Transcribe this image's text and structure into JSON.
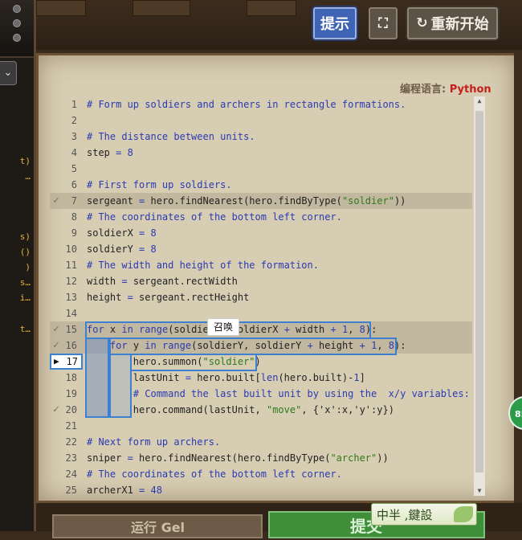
{
  "toolbar": {
    "hint_label": "提示",
    "fullscreen_icon": "⛶",
    "restart_icon": "↻",
    "restart_label": "重新开始"
  },
  "editor": {
    "language_prefix": "编程语言: ",
    "language": "Python",
    "current_line": "17",
    "tooltip": "召唤",
    "lines": [
      {
        "n": "1",
        "text": "# Form up soldiers and archers in rectangle formations.",
        "type": "comment"
      },
      {
        "n": "2",
        "text": "",
        "type": "code"
      },
      {
        "n": "3",
        "text": "# The distance between units.",
        "type": "comment"
      },
      {
        "n": "4",
        "text": "step = 8",
        "type": "code"
      },
      {
        "n": "5",
        "text": "",
        "type": "code"
      },
      {
        "n": "6",
        "text": "# First form up soldiers.",
        "type": "comment"
      },
      {
        "n": "7",
        "text": "sergeant = hero.findNearest(hero.findByType(\"soldier\"))",
        "type": "code",
        "check": true,
        "hl": true
      },
      {
        "n": "8",
        "text": "# The coordinates of the bottom left corner.",
        "type": "comment"
      },
      {
        "n": "9",
        "text": "soldierX = 8",
        "type": "code"
      },
      {
        "n": "10",
        "text": "soldierY = 8",
        "type": "code"
      },
      {
        "n": "11",
        "text": "# The width and height of the formation.",
        "type": "comment"
      },
      {
        "n": "12",
        "text": "width = sergeant.rectWidth",
        "type": "code"
      },
      {
        "n": "13",
        "text": "height = sergeant.rectHeight",
        "type": "code"
      },
      {
        "n": "14",
        "text": "",
        "type": "code"
      },
      {
        "n": "15",
        "text": "for x in range(soldierX, soldierX + width + 1, 8):",
        "type": "code",
        "check": true,
        "hl": true
      },
      {
        "n": "16",
        "text": "    for y in range(soldierY, soldierY + height + 1, 8):",
        "type": "code",
        "check": true,
        "hl": true
      },
      {
        "n": "17",
        "text": "        hero.summon(\"soldier\")",
        "type": "code"
      },
      {
        "n": "18",
        "text": "        lastUnit = hero.built[len(hero.built)-1]",
        "type": "code"
      },
      {
        "n": "19",
        "text": "        # Command the last built unit by using the  x/y variables:",
        "type": "comment"
      },
      {
        "n": "20",
        "text": "        hero.command(lastUnit, \"move\", {'x':x,'y':y})",
        "type": "code",
        "check": true
      },
      {
        "n": "21",
        "text": "",
        "type": "code"
      },
      {
        "n": "22",
        "text": "# Next form up archers.",
        "type": "comment"
      },
      {
        "n": "23",
        "text": "sniper = hero.findNearest(hero.findByType(\"archer\"))",
        "type": "code"
      },
      {
        "n": "24",
        "text": "# The coordinates of the bottom left corner.",
        "type": "comment"
      },
      {
        "n": "25",
        "text": "archerX1 = 48",
        "type": "code"
      }
    ]
  },
  "left_panel": {
    "dropdown_icon": "⌄",
    "snippets": [
      "t)",
      "…",
      "s)",
      "()",
      ")",
      "s…",
      "i…",
      "t…"
    ]
  },
  "side_badge": "85",
  "bottom": {
    "run_label": "运行 Gel",
    "submit_label": "提交",
    "ime_label": "中半 ,鍵設"
  }
}
